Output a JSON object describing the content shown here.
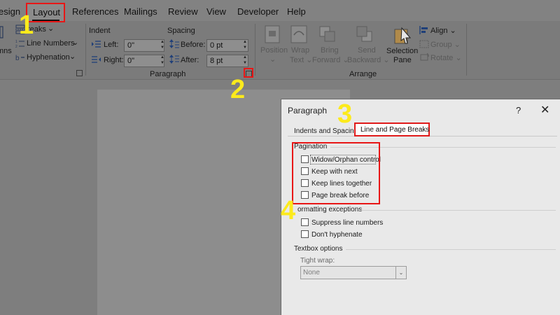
{
  "tabs": {
    "design": "esign",
    "layout": "Layout",
    "references": "References",
    "mailings": "Mailings",
    "review": "Review",
    "view": "View",
    "developer": "Developer",
    "help": "Help"
  },
  "ribbon": {
    "page_setup": {
      "breaks": "reaks",
      "breaks_caret": "⌄",
      "line_numbers": "Line Numbers",
      "line_numbers_caret": "⌄",
      "hyphenation": "Hyphenation",
      "hyphenation_caret": "⌄",
      "columns_fragment": "mns"
    },
    "paragraph": {
      "group_label": "Paragraph",
      "indent_label": "Indent",
      "spacing_label": "Spacing",
      "left_label": "Left:",
      "left_value": "0\"",
      "right_label": "Right:",
      "right_value": "0\"",
      "before_label": "Before:",
      "before_value": "0 pt",
      "after_label": "After:",
      "after_value": "8 pt"
    },
    "arrange": {
      "group_label": "Arrange",
      "position_label": "Position",
      "position_caret": "⌄",
      "wrap_text_line1": "Wrap",
      "wrap_text_line2": "Text ⌄",
      "bring_forward_line1": "Bring",
      "bring_forward_line2": "Forward ⌄",
      "send_backward_line1": "Send",
      "send_backward_line2": "Backward ⌄",
      "selection_pane_line1": "Selection",
      "selection_pane_line2": "Pane",
      "align_label": "Align ⌄",
      "group_btn_label": "Group ⌄",
      "rotate_label": "Rotate ⌄"
    }
  },
  "dialog": {
    "title": "Paragraph",
    "help_glyph": "?",
    "close_glyph": "✕",
    "tab_indents": "Indents and Spacing",
    "tab_line_breaks": "Line and Page Breaks",
    "pagination_label": "Pagination",
    "pagination_items": [
      "Widow/Orphan control",
      "Keep with next",
      "Keep lines together",
      "Page break before"
    ],
    "formatting_exceptions_label": "ormatting exceptions",
    "exceptions_items": [
      "Suppress line numbers",
      "Don't hyphenate"
    ],
    "textbox_options_label": "Textbox options",
    "tight_wrap_label": "Tight wrap:",
    "tight_wrap_value": "None",
    "tight_wrap_caret": "⌄"
  },
  "annotations": {
    "step1": "1",
    "step2": "2",
    "step3": "3",
    "step4": "4"
  },
  "colors": {
    "highlight_red": "#e81616",
    "step_yellow": "#fcea1c"
  }
}
